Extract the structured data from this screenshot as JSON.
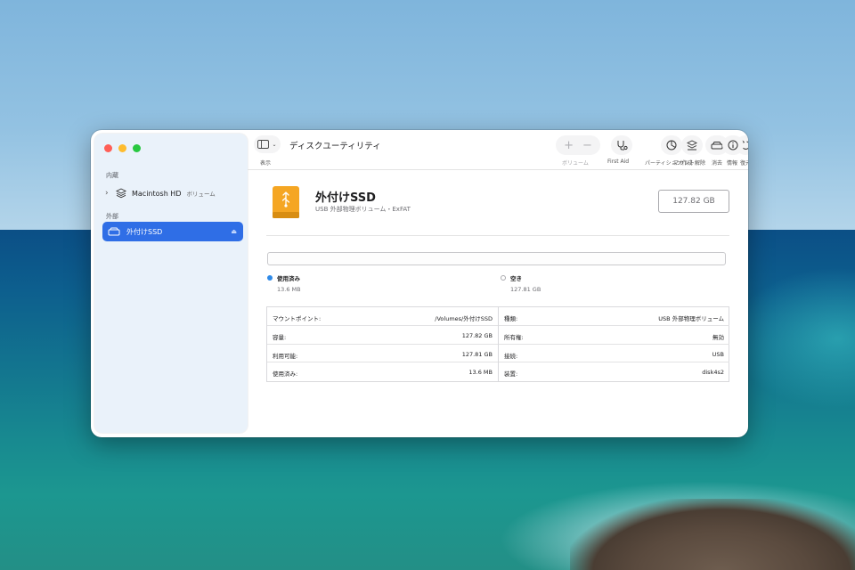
{
  "window": {
    "title": "ディスクユーティリティ"
  },
  "toolbar": {
    "view_label": "表示",
    "buttons": [
      {
        "id": "volume",
        "label": "ボリューム",
        "enabled": false
      },
      {
        "id": "firstaid",
        "label": "First Aid",
        "enabled": true
      },
      {
        "id": "partition",
        "label": "パーティション作成",
        "enabled": true
      },
      {
        "id": "erase",
        "label": "消去",
        "enabled": true
      },
      {
        "id": "restore",
        "label": "復元",
        "enabled": true
      },
      {
        "id": "unmount",
        "label": "マウント解除",
        "enabled": true
      },
      {
        "id": "info",
        "label": "情報",
        "enabled": true
      }
    ]
  },
  "sidebar": {
    "internal_header": "内蔵",
    "internal_items": [
      {
        "label": "Macintosh HD",
        "sub": "ボリューム"
      }
    ],
    "external_header": "外部",
    "external_items": [
      {
        "label": "外付けSSD",
        "selected": true
      }
    ]
  },
  "disk": {
    "name": "外付けSSD",
    "subtitle": "USB 外部物理ボリューム・ExFAT",
    "capacity": "127.82 GB"
  },
  "usage": {
    "used_fraction": 0.0001,
    "used_label": "使用済み",
    "used_value": "13.6 MB",
    "used_color": "#2f8ae8",
    "free_label": "空き",
    "free_value": "127.81 GB"
  },
  "info": {
    "left": [
      {
        "key": "マウントポイント:",
        "value": "/Volumes/外付けSSD"
      },
      {
        "key": "容量:",
        "value": "127.82 GB"
      },
      {
        "key": "利用可能:",
        "value": "127.81 GB"
      },
      {
        "key": "使用済み:",
        "value": "13.6 MB"
      }
    ],
    "right": [
      {
        "key": "種類:",
        "value": "USB 外部物理ボリューム"
      },
      {
        "key": "所有権:",
        "value": "無効"
      },
      {
        "key": "接続:",
        "value": "USB"
      },
      {
        "key": "装置:",
        "value": "disk4s2"
      }
    ]
  },
  "colors": {
    "accent": "#2f6ee6",
    "disk_icon": "#f5a623"
  }
}
